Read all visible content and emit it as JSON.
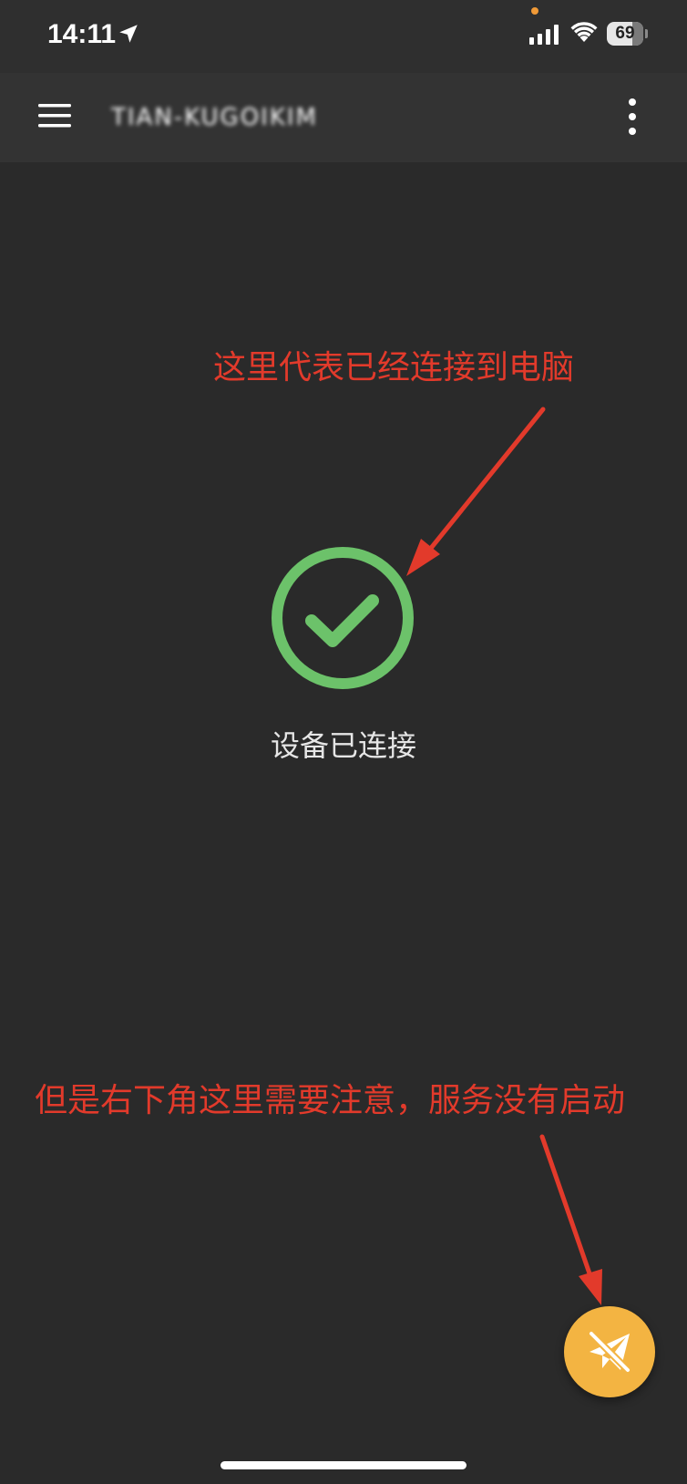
{
  "status_bar": {
    "time": "14:11",
    "battery": "69",
    "icons": [
      "location-arrow-icon",
      "signal-icon",
      "wifi-icon",
      "battery-icon"
    ]
  },
  "app_bar": {
    "title": "TIAN-KUGOIKIM",
    "icons": [
      "menu-icon",
      "more-vertical-icon"
    ]
  },
  "main": {
    "status_icon": "check-circle-icon",
    "status_label": "设备已连接"
  },
  "annotations": {
    "top": "这里代表已经连接到电脑",
    "bottom": "但是右下角这里需要注意，服务没有启动"
  },
  "fab": {
    "icon": "send-off-icon"
  },
  "colors": {
    "background": "#2a2a2a",
    "app_bar": "#333333",
    "success": "#6cc26a",
    "annotation": "#e23a2b",
    "fab": "#f3b442"
  }
}
